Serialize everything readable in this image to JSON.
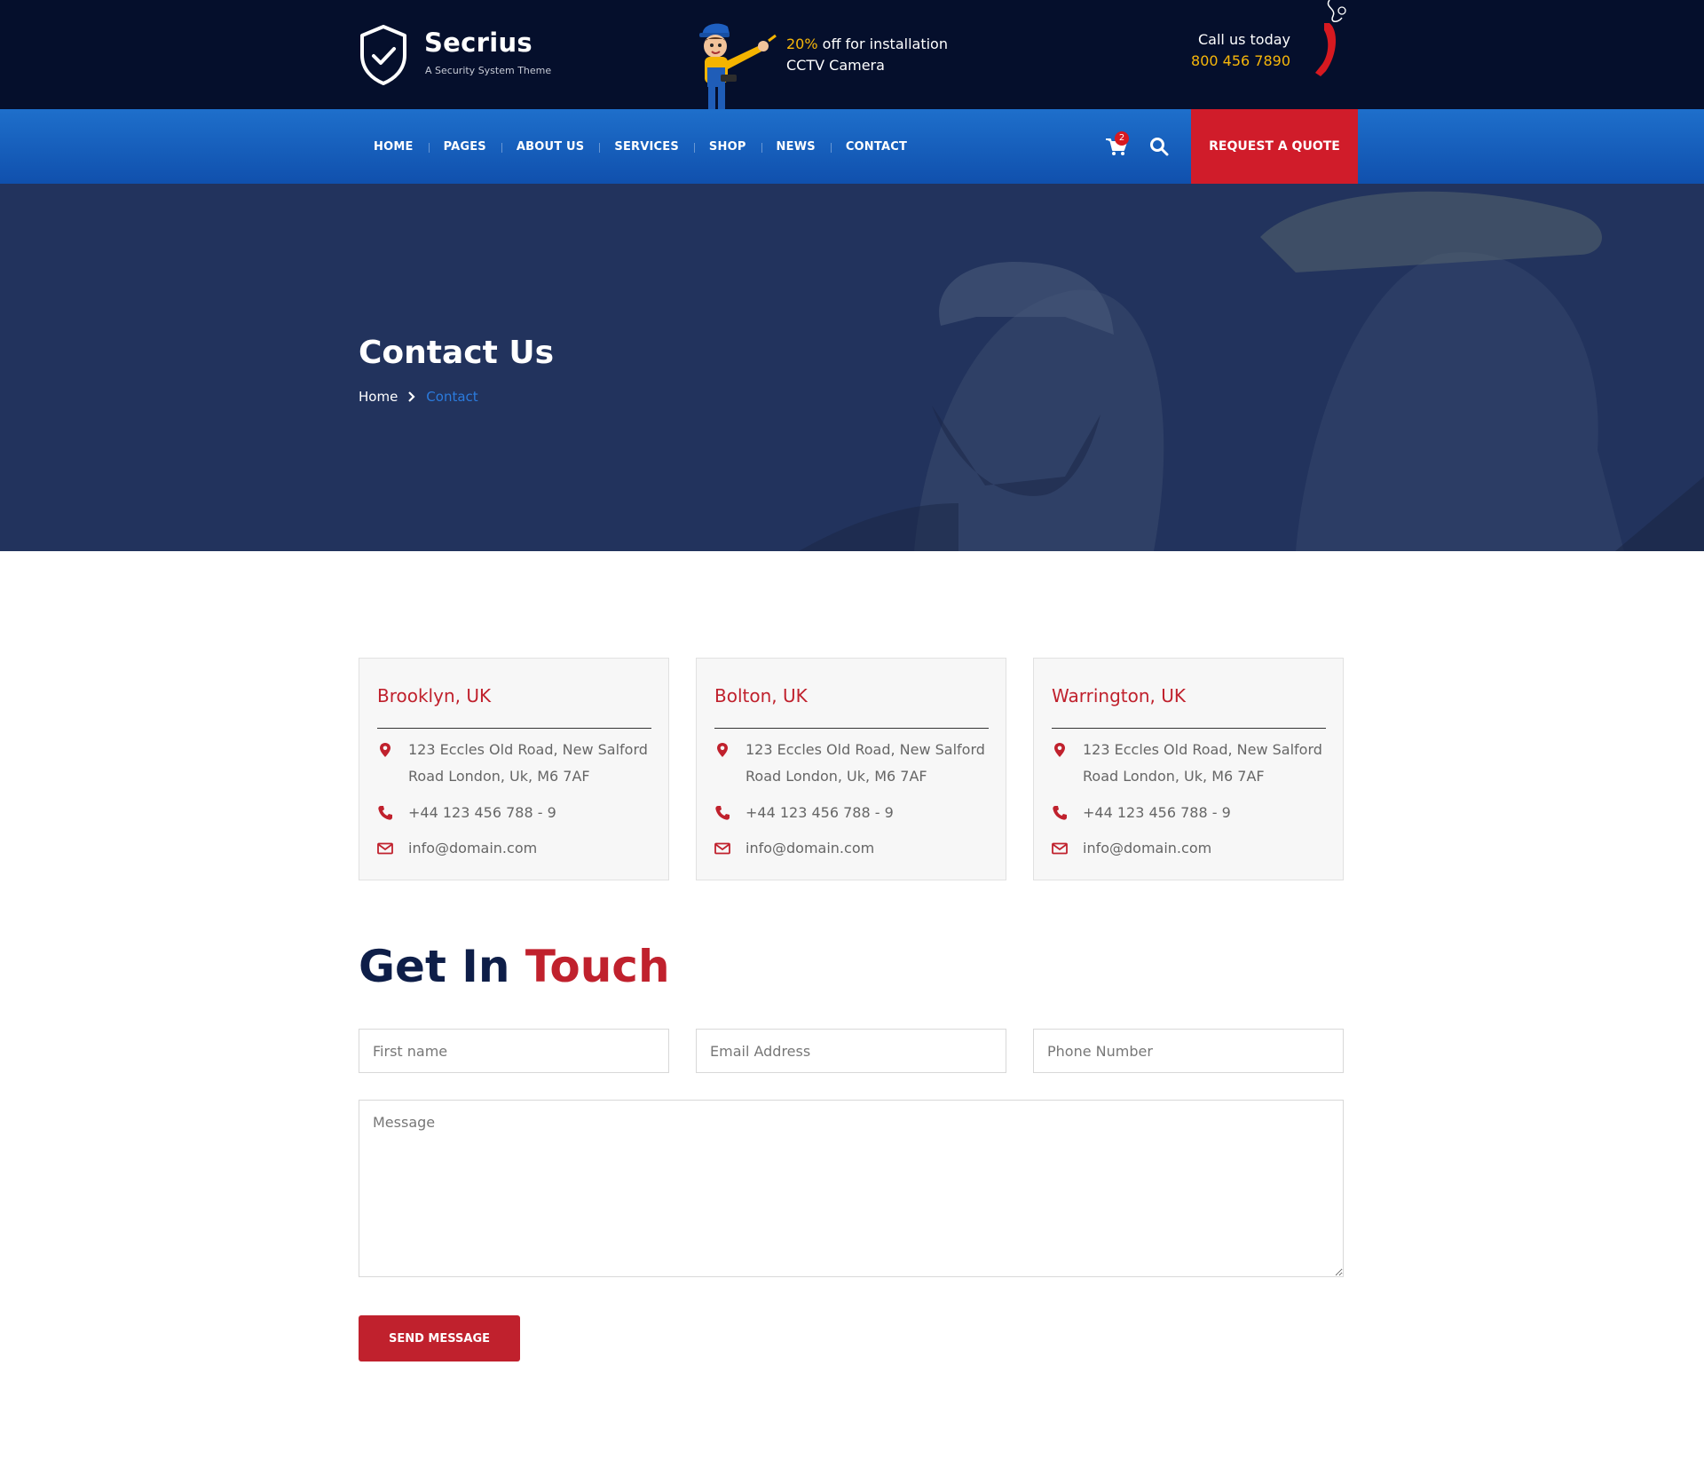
{
  "header": {
    "brand": {
      "name": "Secrius",
      "tagline": "A Security System Theme"
    },
    "promo": {
      "highlight": "20%",
      "line1_rest": " off for installation",
      "line2": "CCTV Camera"
    },
    "call": {
      "label": "Call us today",
      "number": "800 456 7890"
    }
  },
  "nav": {
    "items": [
      "HOME",
      "PAGES",
      "ABOUT US",
      "SERVICES",
      "SHOP",
      "NEWS",
      "CONTACT"
    ],
    "cart_count": "2",
    "quote_label": "REQUEST A QUOTE"
  },
  "hero": {
    "title": "Contact Us",
    "breadcrumb": {
      "home": "Home",
      "current": "Contact"
    }
  },
  "offices": [
    {
      "city": "Brooklyn, UK",
      "address": "123 Eccles Old Road, New Salford Road London, Uk, M6 7AF",
      "phone": "+44 123 456 788 - 9",
      "email": "info@domain.com"
    },
    {
      "city": "Bolton, UK",
      "address": "123 Eccles Old Road, New Salford Road London, Uk, M6 7AF",
      "phone": "+44 123 456 788 - 9",
      "email": "info@domain.com"
    },
    {
      "city": "Warrington, UK",
      "address": "123 Eccles Old Road, New Salford Road London, Uk, M6 7AF",
      "phone": "+44 123 456 788 - 9",
      "email": "info@domain.com"
    }
  ],
  "contact_form": {
    "title_part1": "Get In",
    "title_part2": "Touch",
    "first_name_placeholder": "First name",
    "email_placeholder": "Email Address",
    "phone_placeholder": "Phone Number",
    "message_placeholder": "Message",
    "submit_label": "SEND MESSAGE"
  },
  "colors": {
    "topbar": "#050f2c",
    "nav_blue": "#1660bd",
    "accent_red": "#c0212d",
    "highlight_yellow": "#f7b70a",
    "heading_navy": "#0e1e48"
  },
  "icons": [
    "shield-check-icon",
    "mascot-illustration",
    "phone-handset-icon",
    "cart-icon",
    "search-icon",
    "chevron-right-icon",
    "map-pin-icon",
    "phone-icon",
    "envelope-icon"
  ]
}
